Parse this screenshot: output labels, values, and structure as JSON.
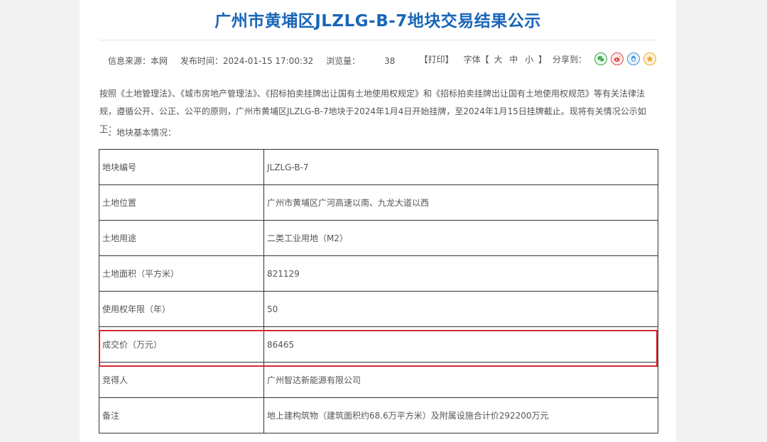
{
  "article": {
    "title": "广州市黄埔区JLZLG-B-7地块交易结果公示",
    "meta": {
      "source": "信息来源：本网",
      "published": "发布时间：2024-01-15 17:00:32",
      "views_label": "浏览量：",
      "views_count": "38"
    },
    "tools": {
      "print": "【打印】",
      "font_label": "字体【",
      "font_large": "大",
      "font_medium": "中",
      "font_small": "小",
      "font_close": "】",
      "share_label": "分享到：",
      "share_icons": [
        "wechat-icon",
        "weibo-icon",
        "qq-icon",
        "qzone-icon"
      ]
    },
    "intro": "按照《土地管理法》、《城市房地产管理法》、《招标拍卖挂牌出让国有土地使用权规定》和《招标拍卖挂牌出让国有土地使用权规范》等有关法律法规，遵循公开、公正、公平的原则，广州市黄埔区JLZLG-B-7地块于2024年1月4日开始挂牌，至2024年1月15日挂牌截止。现将有关情况公示如下：",
    "section_heading": "一、地块基本情况："
  },
  "table": {
    "rows": [
      {
        "label": "地块编号",
        "value": "JLZLG-B-7"
      },
      {
        "label": "土地位置",
        "value": "广州市黄埔区广河高速以南、九龙大道以西"
      },
      {
        "label": "土地用途",
        "value": "二类工业用地（M2）"
      },
      {
        "label": "土地面积（平方米）",
        "value": "821129"
      },
      {
        "label": "使用权年限（年）",
        "value": "50"
      },
      {
        "label": "成交价（万元）",
        "value": "86465"
      },
      {
        "label": "竞得人",
        "value": "广州智达新能源有限公司"
      },
      {
        "label": "备注",
        "value": "地上建构筑物（建筑面积约68.6万平方米）及附属设施合计价292200万元"
      }
    ]
  },
  "colors": {
    "title": "#1a66b8",
    "highlight_border": "#d9282f",
    "page_background": "#f2f2f2"
  }
}
